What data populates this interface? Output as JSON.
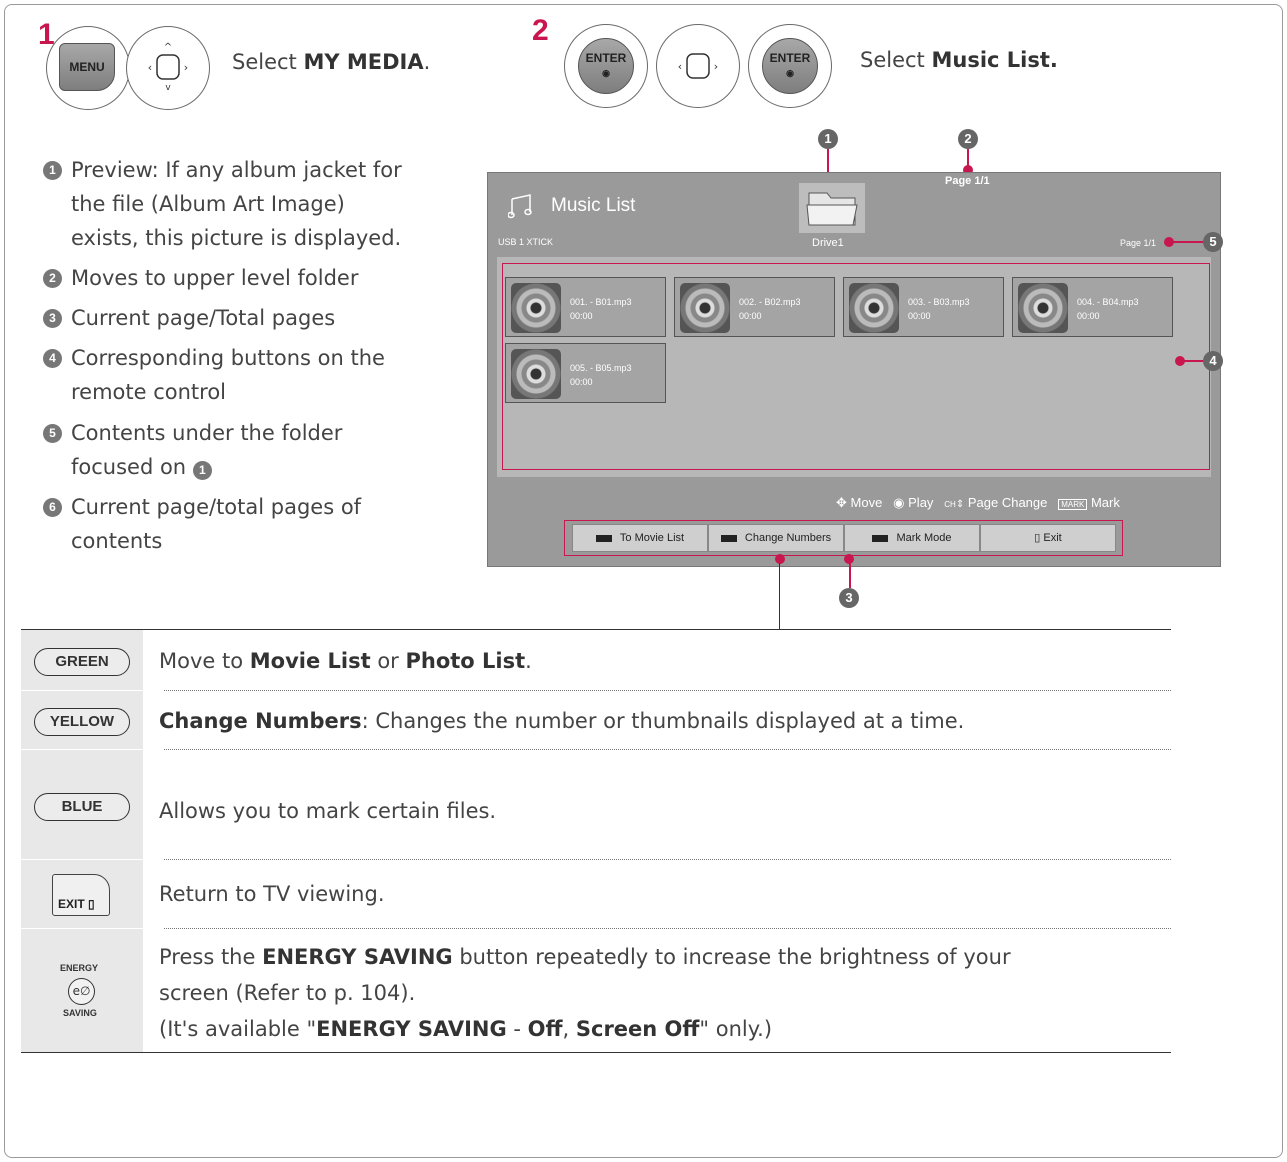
{
  "steps": {
    "one": {
      "number": "1",
      "menu_key": "MENU",
      "prefix": "Select ",
      "target": "MY MEDIA",
      "suffix": "."
    },
    "two": {
      "number": "2",
      "enter_key": "ENTER",
      "prefix": "Select ",
      "target": "Music List."
    }
  },
  "legend": [
    {
      "num": "1",
      "lines": [
        "Preview: If any album jacket for",
        "the file (Album Art Image)",
        "exists, this picture is displayed."
      ]
    },
    {
      "num": "2",
      "lines": [
        "Moves to upper level folder"
      ]
    },
    {
      "num": "3",
      "lines": [
        "Current page/Total pages"
      ]
    },
    {
      "num": "4",
      "lines": [
        "Corresponding buttons on the",
        "remote control"
      ]
    },
    {
      "num": "5",
      "lines": [
        "Contents under the folder",
        "focused on "
      ],
      "ref": "1"
    },
    {
      "num": "6",
      "lines": [
        "Current page/total pages of",
        "contents"
      ]
    }
  ],
  "screen": {
    "title": "Music List",
    "source": "USB 1 XTICK",
    "drive": "Drive1",
    "page_top": "Page 1/1",
    "page_right": "Page 1/1",
    "files": [
      {
        "name": "001. - B01.mp3",
        "time": "00:00"
      },
      {
        "name": "002. - B02.mp3",
        "time": "00:00"
      },
      {
        "name": "003. - B03.mp3",
        "time": "00:00"
      },
      {
        "name": "004. - B04.mp3",
        "time": "00:00"
      },
      {
        "name": "005. - B05.mp3",
        "time": "00:00"
      }
    ],
    "hints": {
      "move": "Move",
      "play": "Play",
      "ch": "CH",
      "page_change": "Page Change",
      "mark_key": "MARK",
      "mark": "Mark"
    },
    "buttons": [
      "To Movie List",
      "Change Numbers",
      "Mark Mode",
      "Exit"
    ]
  },
  "callouts": [
    "1",
    "2",
    "3",
    "4",
    "5"
  ],
  "table": {
    "green": {
      "key": "GREEN",
      "pre": "Move to ",
      "b1": "Movie List",
      "mid": " or ",
      "b2": "Photo List",
      "post": "."
    },
    "yellow": {
      "key": "YELLOW",
      "b1": "Change Numbers",
      "post": ": Changes the number or thumbnails displayed at a time."
    },
    "blue": {
      "key": "BLUE",
      "text": "Allows you to mark certain files."
    },
    "exit": {
      "key": "EXIT",
      "text": "Return to TV viewing."
    },
    "energy": {
      "key_top": "ENERGY",
      "key_bottom": "SAVING",
      "pre": "Press the ",
      "b1": "ENERGY SAVING",
      "post1": " button repeatedly to increase the brightness of your",
      "line2": "screen (Refer to p. 104).",
      "l3_pre": "(It's available \"",
      "l3_b1": "ENERGY SAVING",
      "l3_dash": " - ",
      "l3_b2": "Off",
      "l3_comma": ", ",
      "l3_b3": "Screen Off",
      "l3_post": "\" only.)"
    }
  }
}
